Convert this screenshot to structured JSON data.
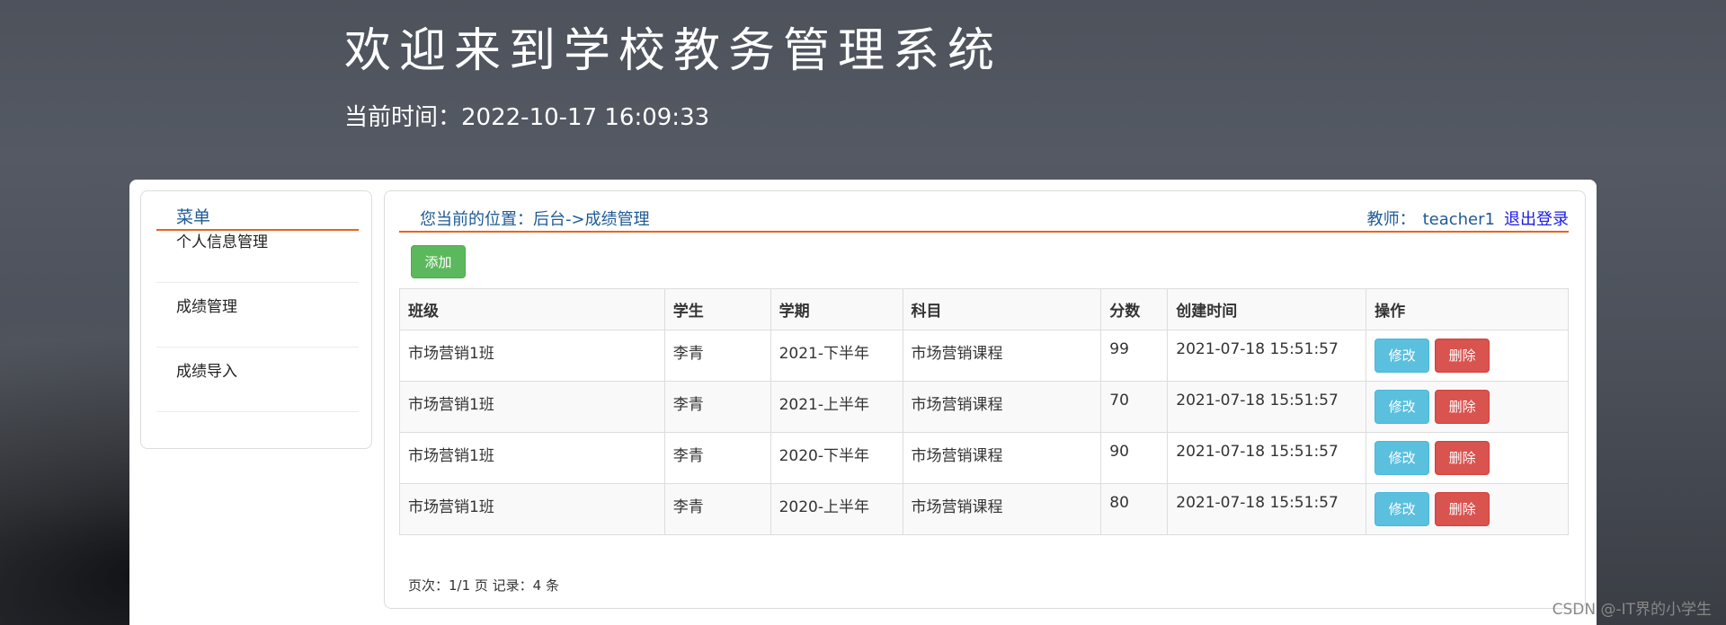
{
  "header": {
    "title": "欢迎来到学校教务管理系统",
    "time_label": "当前时间：",
    "time_value": "2022-10-17 16:09:33"
  },
  "sidebar": {
    "title": "菜单",
    "items": [
      {
        "label": "个人信息管理"
      },
      {
        "label": "成绩管理"
      },
      {
        "label": "成绩导入"
      }
    ]
  },
  "content": {
    "breadcrumb": "您当前的位置：后台->成绩管理",
    "user_role": "教师：",
    "user_name": "teacher1",
    "logout_label": "退出登录",
    "add_label": "添加"
  },
  "table": {
    "headers": [
      "班级",
      "学生",
      "学期",
      "科目",
      "分数",
      "创建时间",
      "操作"
    ],
    "rows": [
      {
        "class": "市场营销1班",
        "student": "李青",
        "term": "2021-下半年",
        "subject": "市场营销课程",
        "score": "99",
        "created": "2021-07-18 15:51:57"
      },
      {
        "class": "市场营销1班",
        "student": "李青",
        "term": "2021-上半年",
        "subject": "市场营销课程",
        "score": "70",
        "created": "2021-07-18 15:51:57"
      },
      {
        "class": "市场营销1班",
        "student": "李青",
        "term": "2020-下半年",
        "subject": "市场营销课程",
        "score": "90",
        "created": "2021-07-18 15:51:57"
      },
      {
        "class": "市场营销1班",
        "student": "李青",
        "term": "2020-上半年",
        "subject": "市场营销课程",
        "score": "80",
        "created": "2021-07-18 15:51:57"
      }
    ],
    "edit_label": "修改",
    "delete_label": "删除"
  },
  "pager": {
    "text": "页次：1/1 页 记录：4 条"
  },
  "watermark": "CSDN @-IT界的小学生",
  "colors": {
    "accent_line": "#e8641d",
    "link_blue": "#1e5a96",
    "add_green": "#5cb85c",
    "edit_cyan": "#5bc0de",
    "delete_red": "#d9534f"
  }
}
